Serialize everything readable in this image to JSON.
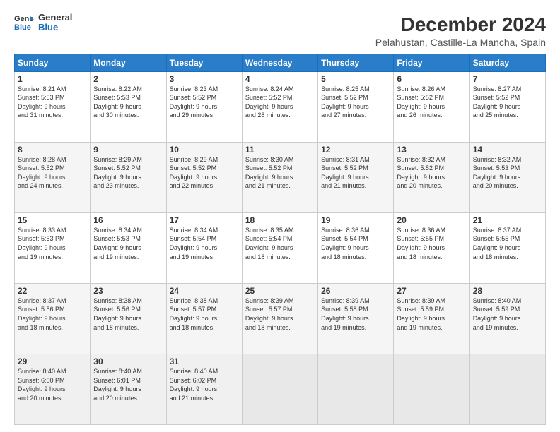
{
  "header": {
    "logo_line1": "General",
    "logo_line2": "Blue",
    "title": "December 2024",
    "subtitle": "Pelahustan, Castille-La Mancha, Spain"
  },
  "days_of_week": [
    "Sunday",
    "Monday",
    "Tuesday",
    "Wednesday",
    "Thursday",
    "Friday",
    "Saturday"
  ],
  "weeks": [
    [
      {
        "day": "1",
        "info": "Sunrise: 8:21 AM\nSunset: 5:53 PM\nDaylight: 9 hours\nand 31 minutes."
      },
      {
        "day": "2",
        "info": "Sunrise: 8:22 AM\nSunset: 5:53 PM\nDaylight: 9 hours\nand 30 minutes."
      },
      {
        "day": "3",
        "info": "Sunrise: 8:23 AM\nSunset: 5:52 PM\nDaylight: 9 hours\nand 29 minutes."
      },
      {
        "day": "4",
        "info": "Sunrise: 8:24 AM\nSunset: 5:52 PM\nDaylight: 9 hours\nand 28 minutes."
      },
      {
        "day": "5",
        "info": "Sunrise: 8:25 AM\nSunset: 5:52 PM\nDaylight: 9 hours\nand 27 minutes."
      },
      {
        "day": "6",
        "info": "Sunrise: 8:26 AM\nSunset: 5:52 PM\nDaylight: 9 hours\nand 26 minutes."
      },
      {
        "day": "7",
        "info": "Sunrise: 8:27 AM\nSunset: 5:52 PM\nDaylight: 9 hours\nand 25 minutes."
      }
    ],
    [
      {
        "day": "8",
        "info": "Sunrise: 8:28 AM\nSunset: 5:52 PM\nDaylight: 9 hours\nand 24 minutes."
      },
      {
        "day": "9",
        "info": "Sunrise: 8:29 AM\nSunset: 5:52 PM\nDaylight: 9 hours\nand 23 minutes."
      },
      {
        "day": "10",
        "info": "Sunrise: 8:29 AM\nSunset: 5:52 PM\nDaylight: 9 hours\nand 22 minutes."
      },
      {
        "day": "11",
        "info": "Sunrise: 8:30 AM\nSunset: 5:52 PM\nDaylight: 9 hours\nand 21 minutes."
      },
      {
        "day": "12",
        "info": "Sunrise: 8:31 AM\nSunset: 5:52 PM\nDaylight: 9 hours\nand 21 minutes."
      },
      {
        "day": "13",
        "info": "Sunrise: 8:32 AM\nSunset: 5:52 PM\nDaylight: 9 hours\nand 20 minutes."
      },
      {
        "day": "14",
        "info": "Sunrise: 8:32 AM\nSunset: 5:53 PM\nDaylight: 9 hours\nand 20 minutes."
      }
    ],
    [
      {
        "day": "15",
        "info": "Sunrise: 8:33 AM\nSunset: 5:53 PM\nDaylight: 9 hours\nand 19 minutes."
      },
      {
        "day": "16",
        "info": "Sunrise: 8:34 AM\nSunset: 5:53 PM\nDaylight: 9 hours\nand 19 minutes."
      },
      {
        "day": "17",
        "info": "Sunrise: 8:34 AM\nSunset: 5:54 PM\nDaylight: 9 hours\nand 19 minutes."
      },
      {
        "day": "18",
        "info": "Sunrise: 8:35 AM\nSunset: 5:54 PM\nDaylight: 9 hours\nand 18 minutes."
      },
      {
        "day": "19",
        "info": "Sunrise: 8:36 AM\nSunset: 5:54 PM\nDaylight: 9 hours\nand 18 minutes."
      },
      {
        "day": "20",
        "info": "Sunrise: 8:36 AM\nSunset: 5:55 PM\nDaylight: 9 hours\nand 18 minutes."
      },
      {
        "day": "21",
        "info": "Sunrise: 8:37 AM\nSunset: 5:55 PM\nDaylight: 9 hours\nand 18 minutes."
      }
    ],
    [
      {
        "day": "22",
        "info": "Sunrise: 8:37 AM\nSunset: 5:56 PM\nDaylight: 9 hours\nand 18 minutes."
      },
      {
        "day": "23",
        "info": "Sunrise: 8:38 AM\nSunset: 5:56 PM\nDaylight: 9 hours\nand 18 minutes."
      },
      {
        "day": "24",
        "info": "Sunrise: 8:38 AM\nSunset: 5:57 PM\nDaylight: 9 hours\nand 18 minutes."
      },
      {
        "day": "25",
        "info": "Sunrise: 8:39 AM\nSunset: 5:57 PM\nDaylight: 9 hours\nand 18 minutes."
      },
      {
        "day": "26",
        "info": "Sunrise: 8:39 AM\nSunset: 5:58 PM\nDaylight: 9 hours\nand 19 minutes."
      },
      {
        "day": "27",
        "info": "Sunrise: 8:39 AM\nSunset: 5:59 PM\nDaylight: 9 hours\nand 19 minutes."
      },
      {
        "day": "28",
        "info": "Sunrise: 8:40 AM\nSunset: 5:59 PM\nDaylight: 9 hours\nand 19 minutes."
      }
    ],
    [
      {
        "day": "29",
        "info": "Sunrise: 8:40 AM\nSunset: 6:00 PM\nDaylight: 9 hours\nand 20 minutes."
      },
      {
        "day": "30",
        "info": "Sunrise: 8:40 AM\nSunset: 6:01 PM\nDaylight: 9 hours\nand 20 minutes."
      },
      {
        "day": "31",
        "info": "Sunrise: 8:40 AM\nSunset: 6:02 PM\nDaylight: 9 hours\nand 21 minutes."
      },
      {
        "day": "",
        "info": ""
      },
      {
        "day": "",
        "info": ""
      },
      {
        "day": "",
        "info": ""
      },
      {
        "day": "",
        "info": ""
      }
    ]
  ]
}
